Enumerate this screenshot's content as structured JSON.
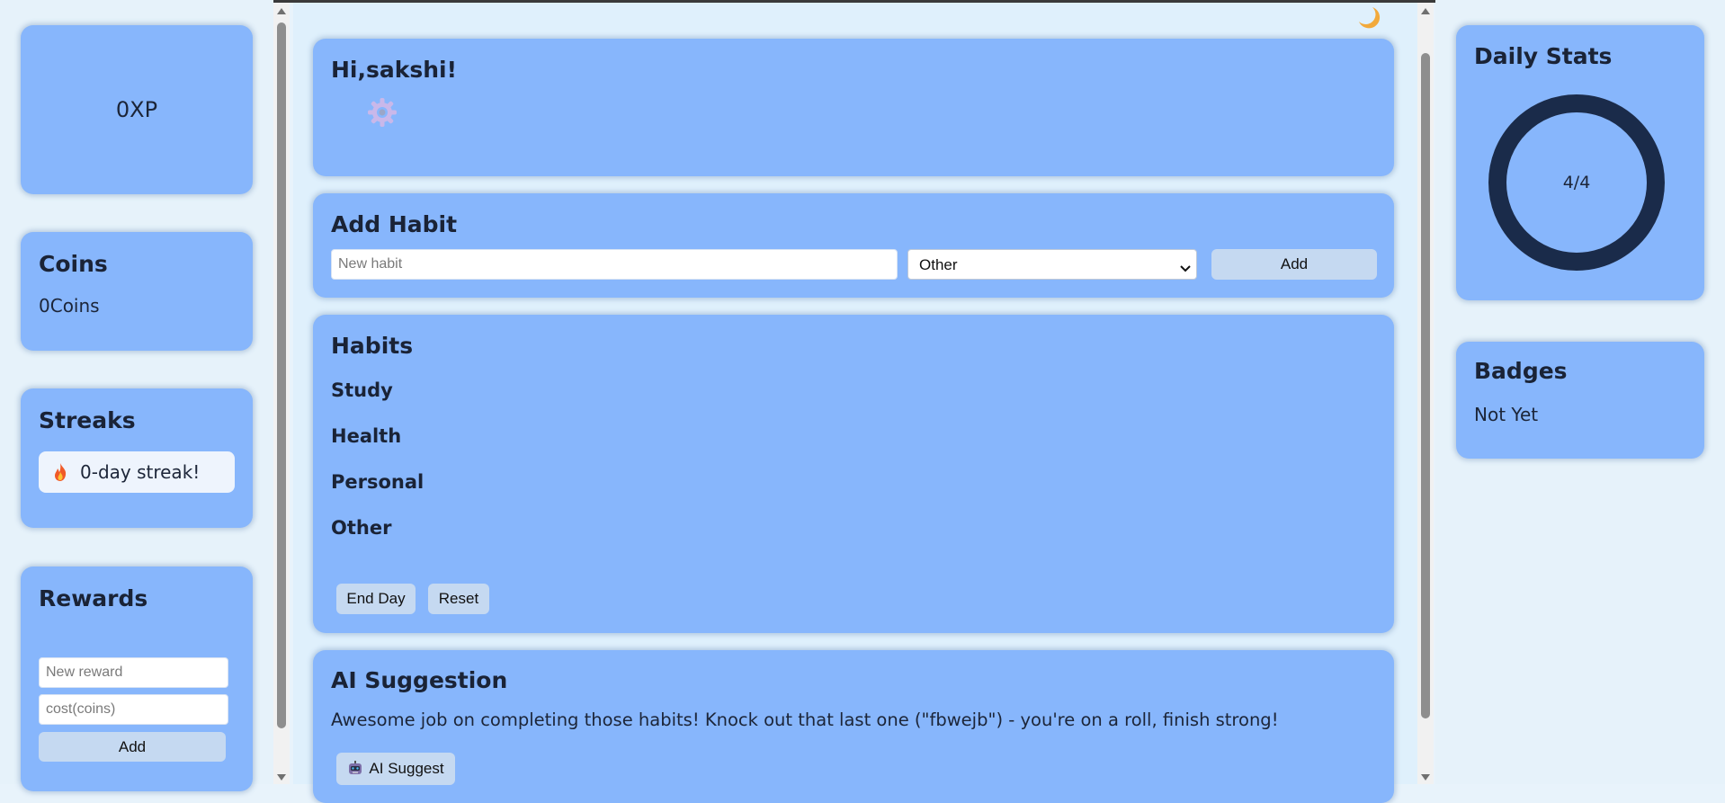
{
  "theme_toggle_icon": "crescent-moon-icon",
  "xp": {
    "value": "0XP"
  },
  "coins": {
    "title": "Coins",
    "value": "0Coins"
  },
  "streaks": {
    "title": "Streaks",
    "badge_icon": "fire-icon",
    "text": "0-day streak!"
  },
  "rewards": {
    "title": "Rewards",
    "name_placeholder": "New reward",
    "cost_placeholder": "cost(coins)",
    "add_label": "Add"
  },
  "greeting": {
    "text": "Hi,sakshi!",
    "icon": "gear-icon"
  },
  "add_habit": {
    "title": "Add Habit",
    "placeholder": "New habit",
    "category_selected": "Other",
    "add_label": "Add"
  },
  "habits": {
    "title": "Habits",
    "categories": [
      "Study",
      "Health",
      "Personal",
      "Other"
    ],
    "end_day_label": "End Day",
    "reset_label": "Reset"
  },
  "ai": {
    "title": "AI Suggestion",
    "text": "Awesome job on completing those habits! Knock out that last one (\"fbwejb\") - you're on a roll, finish strong!",
    "button_label": "AI Suggest",
    "button_icon": "robot-icon"
  },
  "daily_stats": {
    "title": "Daily Stats",
    "progress_text": "4/4",
    "completed": 4,
    "total": 4,
    "ring_color": "#1a2b4a"
  },
  "badges": {
    "title": "Badges",
    "text": "Not Yet"
  }
}
